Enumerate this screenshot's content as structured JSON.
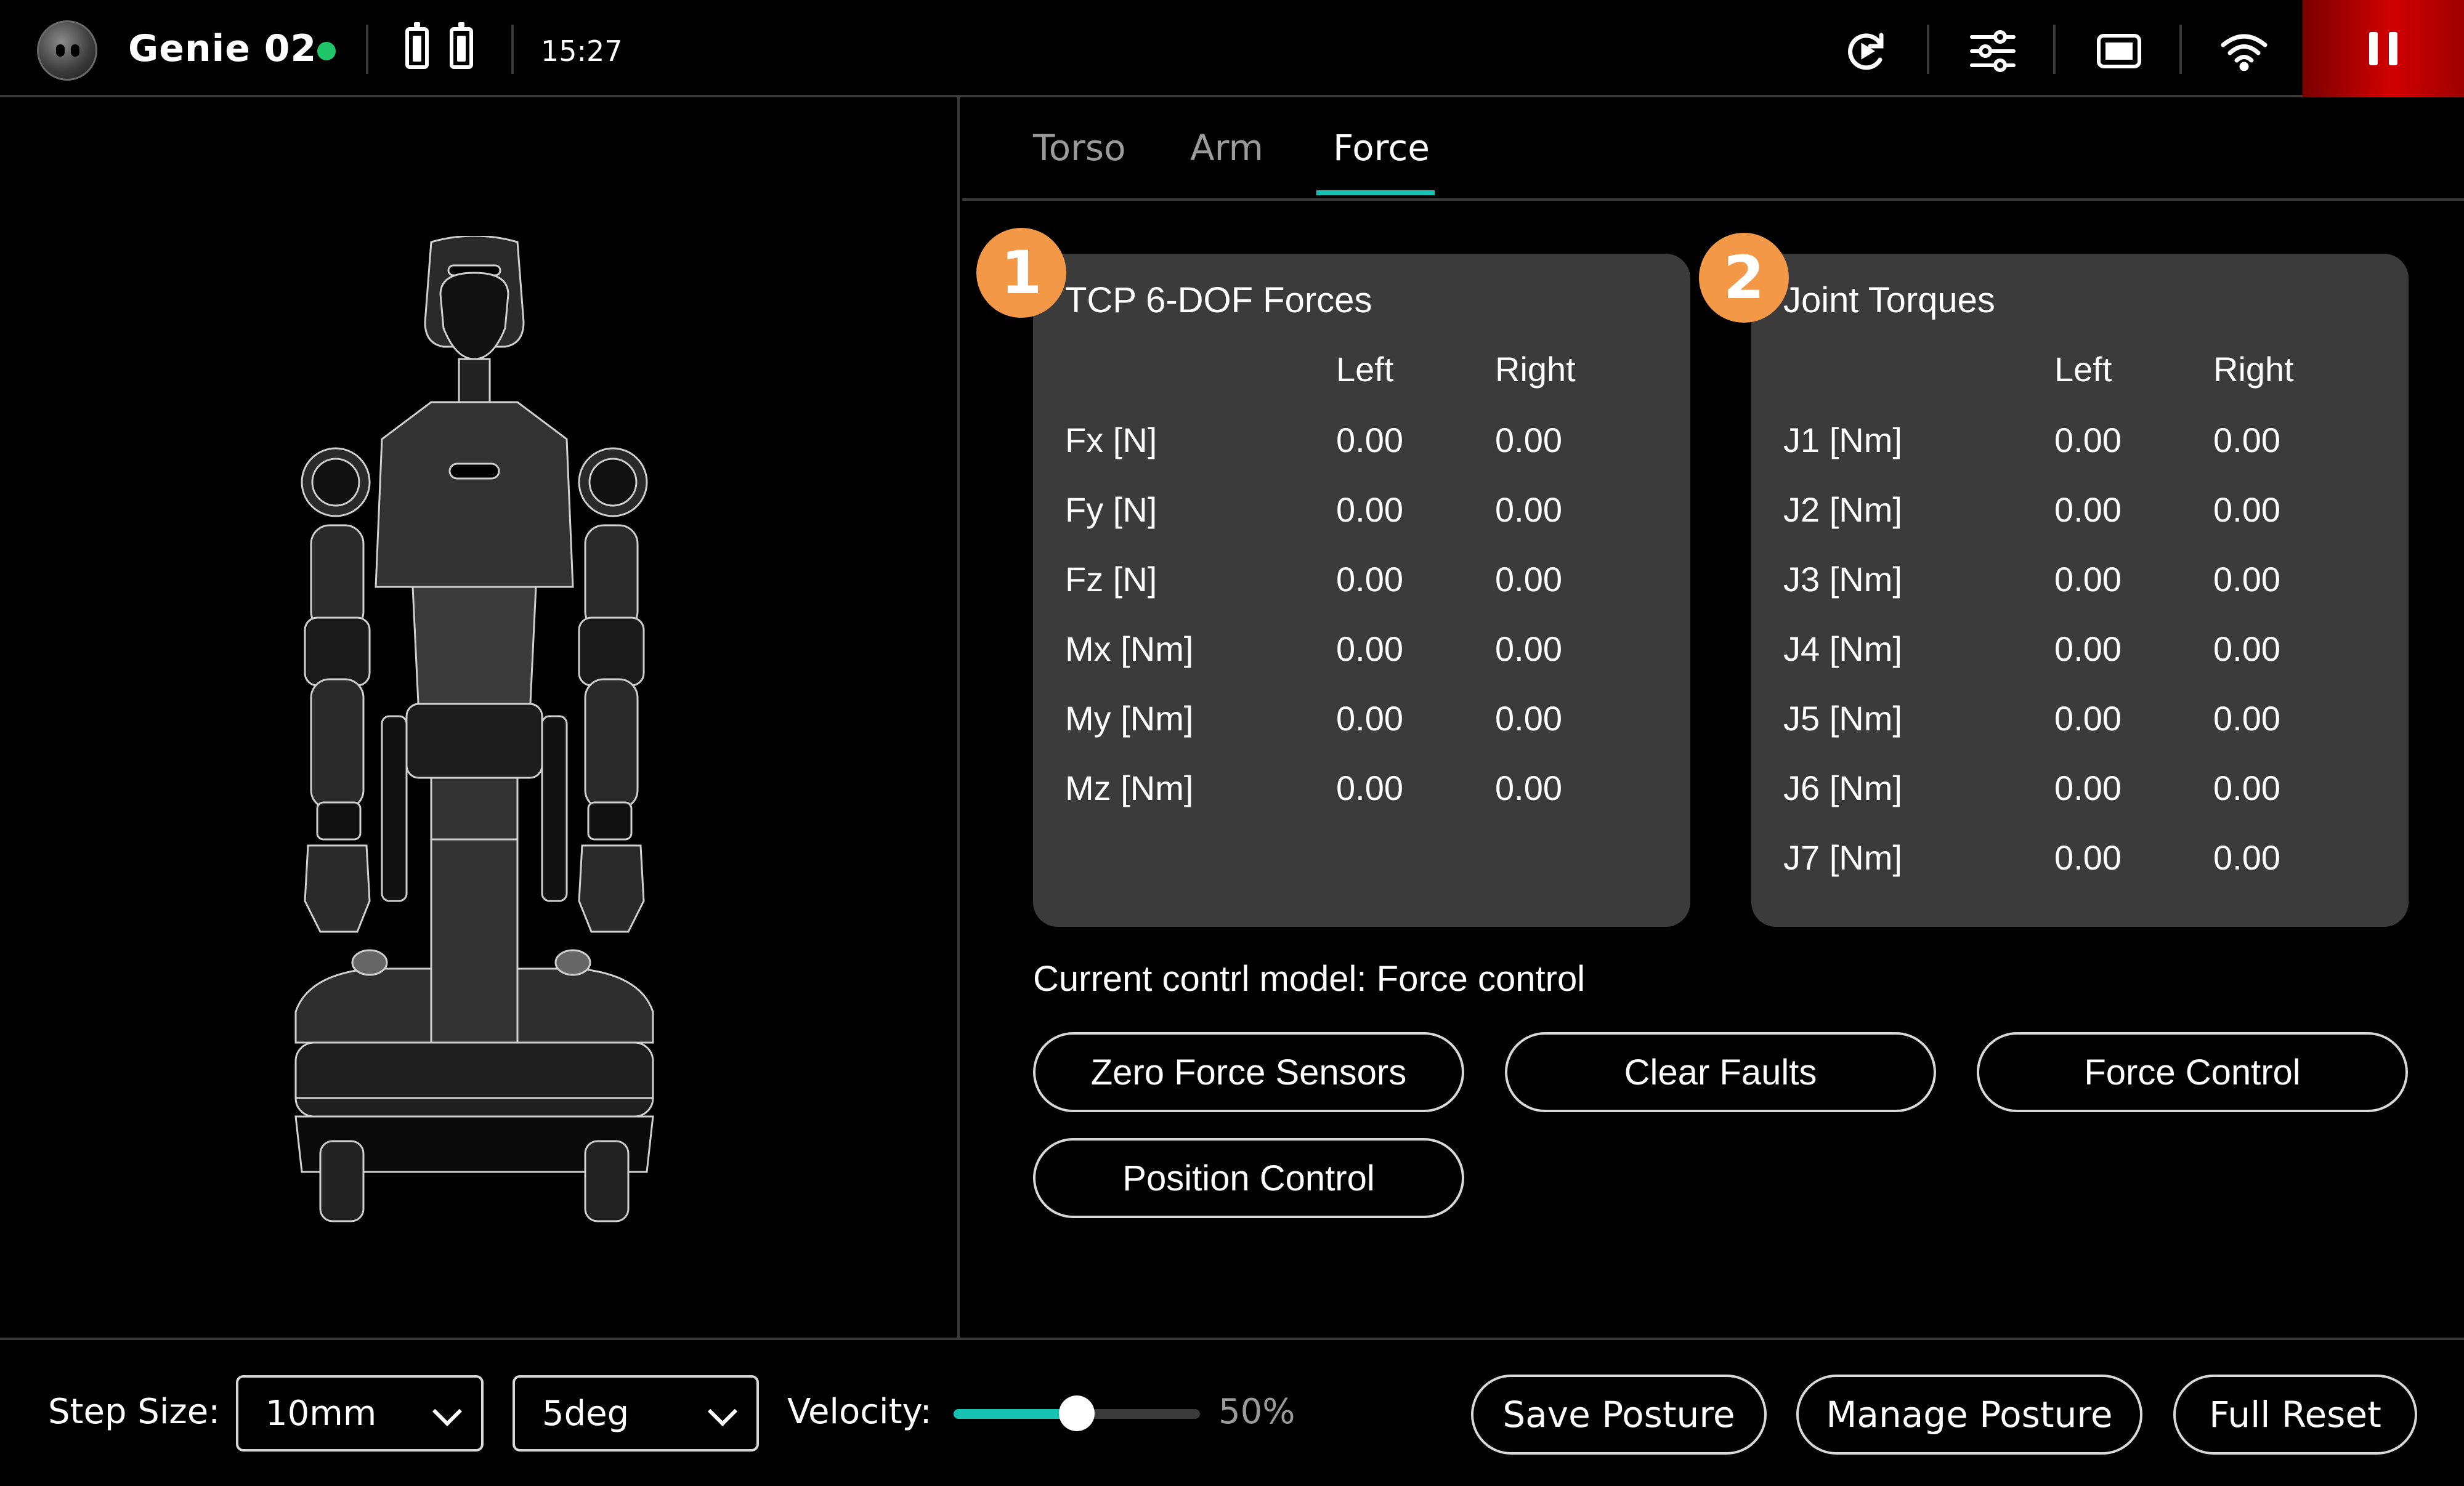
{
  "header": {
    "device_name": "Genie 02",
    "time": "15:27",
    "icons": [
      "reset-icon",
      "sliders-icon",
      "screen-icon",
      "wifi-icon",
      "pause-icon"
    ],
    "status_color": "#1fc76a",
    "stop_color": "#d10000"
  },
  "tabs": [
    {
      "label": "Torso",
      "active": false
    },
    {
      "label": "Arm",
      "active": false
    },
    {
      "label": "Force",
      "active": true
    }
  ],
  "tcp_card": {
    "badge": "1",
    "title": "TCP 6-DOF Forces",
    "col_left": "Left",
    "col_right": "Right",
    "rows": [
      {
        "label": "Fx [N]",
        "left": "0.00",
        "right": "0.00"
      },
      {
        "label": "Fy [N]",
        "left": "0.00",
        "right": "0.00"
      },
      {
        "label": "Fz [N]",
        "left": "0.00",
        "right": "0.00"
      },
      {
        "label": "Mx [Nm]",
        "left": "0.00",
        "right": "0.00"
      },
      {
        "label": "My [Nm]",
        "left": "0.00",
        "right": "0.00"
      },
      {
        "label": "Mz [Nm]",
        "left": "0.00",
        "right": "0.00"
      }
    ]
  },
  "joint_card": {
    "badge": "2",
    "title": "Joint Torques",
    "col_left": "Left",
    "col_right": "Right",
    "rows": [
      {
        "label": "J1 [Nm]",
        "left": "0.00",
        "right": "0.00"
      },
      {
        "label": "J2 [Nm]",
        "left": "0.00",
        "right": "0.00"
      },
      {
        "label": "J3 [Nm]",
        "left": "0.00",
        "right": "0.00"
      },
      {
        "label": "J4 [Nm]",
        "left": "0.00",
        "right": "0.00"
      },
      {
        "label": "J5 [Nm]",
        "left": "0.00",
        "right": "0.00"
      },
      {
        "label": "J6 [Nm]",
        "left": "0.00",
        "right": "0.00"
      },
      {
        "label": "J7 [Nm]",
        "left": "0.00",
        "right": "0.00"
      }
    ]
  },
  "control": {
    "mode_text": "Current contrl model: Force control",
    "buttons": {
      "zero_force": "Zero Force Sensors",
      "clear_faults": "Clear Faults",
      "force_control": "Force Control",
      "position_control": "Position Control"
    }
  },
  "bottom": {
    "step_size_label": "Step Size:",
    "step_size_value": "10mm",
    "angle_value": "5deg",
    "velocity_label": "Velocity:",
    "velocity_value": 0.5,
    "velocity_text": "50%",
    "save_posture": "Save Posture",
    "manage_posture": "Manage Posture",
    "full_reset": "Full Reset",
    "accent": "#17c3b2"
  }
}
